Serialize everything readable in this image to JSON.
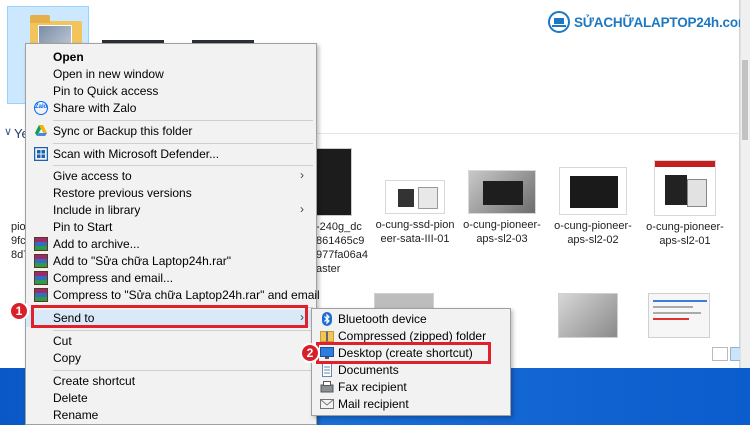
{
  "brand": {
    "name": "SỬACHỮALAPTOP24h.com",
    "color": "#1d78c1"
  },
  "explorer": {
    "section_label": "Yes",
    "partial_left_text": [
      "pio",
      "9fc",
      "8d7"
    ],
    "partial_mid_text": [
      "-240g_dc",
      "861465c9",
      "977fa06a4",
      "aster"
    ],
    "files": [
      {
        "caption": "o-cung-ssd-pion\neer-sata-III-01"
      },
      {
        "caption": "o-cung-pioneer-\naps-sl2-03"
      },
      {
        "caption": "o-cung-pioneer-\naps-sl2-02"
      },
      {
        "caption": "o-cung-pioneer-\naps-sl2-01"
      }
    ]
  },
  "context_menu": {
    "items": [
      {
        "label": "Open",
        "bold": true,
        "icon": ""
      },
      {
        "label": "Open in new window",
        "icon": ""
      },
      {
        "label": "Pin to Quick access",
        "icon": ""
      },
      {
        "label": "Share with Zalo",
        "icon": "zalo-icon"
      },
      {
        "label": "Sync or Backup this folder",
        "icon": "google-drive-icon"
      },
      {
        "label": "Scan with Microsoft Defender...",
        "icon": "defender-icon"
      },
      {
        "label": "Give access to",
        "icon": "",
        "submenu": true
      },
      {
        "label": "Restore previous versions",
        "icon": ""
      },
      {
        "label": "Include in library",
        "icon": "",
        "submenu": true
      },
      {
        "label": "Pin to Start",
        "icon": ""
      },
      {
        "label": "Add to archive...",
        "icon": "winrar-icon"
      },
      {
        "label": "Add to \"Sửa chữa Laptop24h.rar\"",
        "icon": "winrar-icon"
      },
      {
        "label": "Compress and email...",
        "icon": "winrar-icon"
      },
      {
        "label": "Compress to \"Sửa chữa Laptop24h.rar\" and email",
        "icon": "winrar-icon"
      },
      {
        "label": "Send to",
        "icon": "",
        "submenu": true
      },
      {
        "label": "Cut",
        "icon": ""
      },
      {
        "label": "Copy",
        "icon": ""
      },
      {
        "label": "Create shortcut",
        "icon": ""
      },
      {
        "label": "Delete",
        "icon": ""
      },
      {
        "label": "Rename",
        "icon": ""
      }
    ],
    "submenu_arrow": "›"
  },
  "send_to_menu": {
    "items": [
      {
        "label": "Bluetooth device",
        "icon": "bluetooth-icon"
      },
      {
        "label": "Compressed (zipped) folder",
        "icon": "zip-folder-icon"
      },
      {
        "label": "Desktop (create shortcut)",
        "icon": "desktop-icon"
      },
      {
        "label": "Documents",
        "icon": "documents-icon"
      },
      {
        "label": "Fax recipient",
        "icon": "fax-icon"
      },
      {
        "label": "Mail recipient",
        "icon": "mail-icon"
      }
    ]
  },
  "callouts": {
    "step1": "1",
    "step2": "2",
    "color": "#e0202a"
  }
}
